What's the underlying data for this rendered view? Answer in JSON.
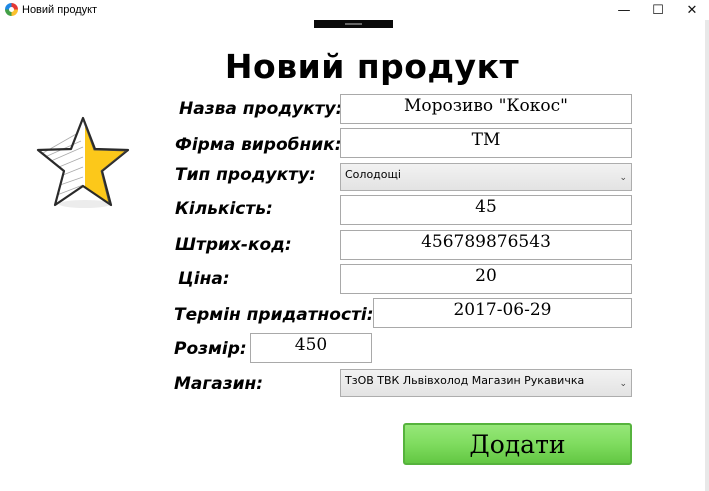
{
  "window": {
    "title": "Новий продукт",
    "minimize_glyph": "—",
    "maximize_glyph": "☐",
    "close_glyph": "✕"
  },
  "form": {
    "heading": "Новий продукт",
    "fields": {
      "name": {
        "label": "Назва продукту:",
        "value": "Морозиво \"Кокос\""
      },
      "manufacturer": {
        "label": "Фірма виробник:",
        "value": "ТМ"
      },
      "type": {
        "label": "Тип продукту:",
        "value": "Солодощі"
      },
      "quantity": {
        "label": "Кількість:",
        "value": "45"
      },
      "barcode": {
        "label": "Штрих-код:",
        "value": "456789876543"
      },
      "price": {
        "label": "Ціна:",
        "value": "20"
      },
      "expiry": {
        "label": "Термін придатності:",
        "value": "2017-06-29"
      },
      "size": {
        "label": "Розмір:",
        "value": "450"
      },
      "store": {
        "label": "Магазин:",
        "value": "ТзОВ ТВК Львівхолод Магазин Рукавичка"
      }
    },
    "submit_label": "Додати"
  },
  "icons": {
    "app": "app-logo-icon",
    "star": "star-icon",
    "dropdown": "chevron-down-icon"
  }
}
